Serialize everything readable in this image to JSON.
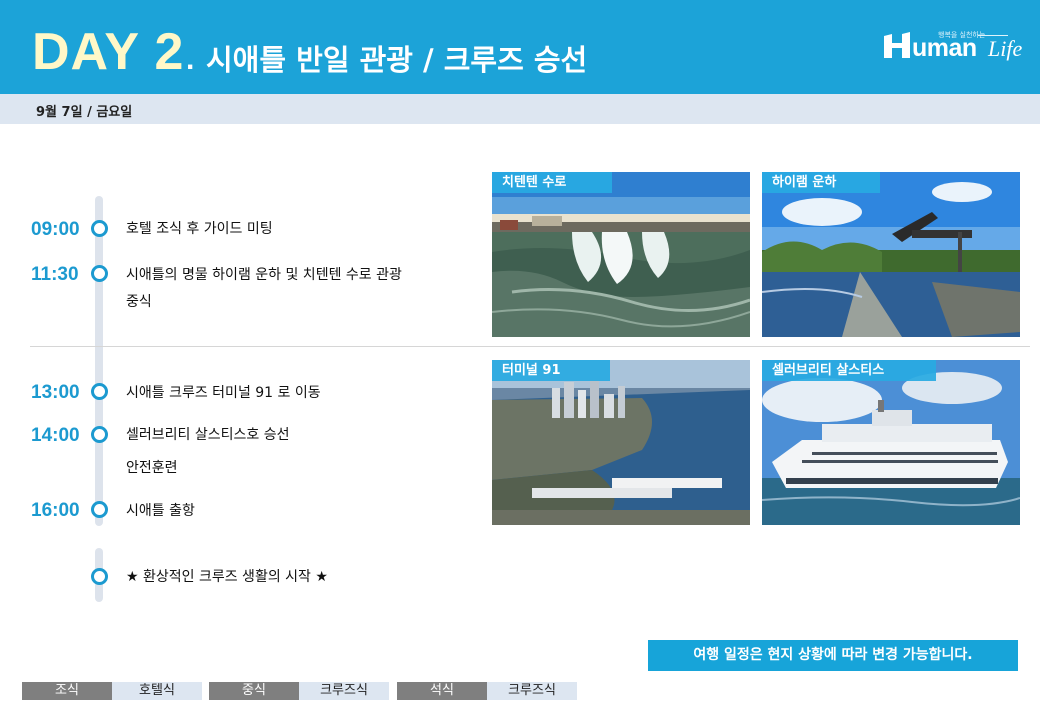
{
  "header": {
    "day_label": "DAY 2",
    "dot": ".",
    "title": "시애틀 반일 관광 / 크루즈 승선"
  },
  "logo": {
    "tagline": "행복을 실천하는",
    "text_h": "H",
    "text_uman": "uman",
    "text_life": "Life"
  },
  "date": "9월 7일 / 금요일",
  "timeline": [
    {
      "time": "09:00",
      "text": "호텔 조식 후 가이드 미팅"
    },
    {
      "time": "11:30",
      "text": "시애틀의 명물 하이램 운하 및 치텐텐 수로 관광",
      "text2": "중식"
    },
    {
      "time": "13:00",
      "text": "시애틀 크루즈 터미널 91 로 이동"
    },
    {
      "time": "14:00",
      "text": "셀러브리티 살스티스호 승선",
      "text2": "안전훈련"
    },
    {
      "time": "16:00",
      "text": "시애틀 출항"
    },
    {
      "time": "",
      "text": "★ 환상적인 크루즈 생활의 시작 ★"
    }
  ],
  "photos": [
    {
      "label": "치텐텐 수로"
    },
    {
      "label": "하이램 운하"
    },
    {
      "label": "터미널 91"
    },
    {
      "label": "셀러브리티 살스티스"
    }
  ],
  "notice": "여행 일정은 현지 상황에 따라 변경 가능합니다.",
  "meals": [
    {
      "key": "조식",
      "value": "호텔식"
    },
    {
      "key": "중식",
      "value": "크루즈식"
    },
    {
      "key": "석식",
      "value": "크루즈식"
    }
  ],
  "colors": {
    "header_bg": "#1ca3d8",
    "accent": "#1c9ad0",
    "day_label": "#fff8c8",
    "date_bar": "#dde6f1"
  }
}
